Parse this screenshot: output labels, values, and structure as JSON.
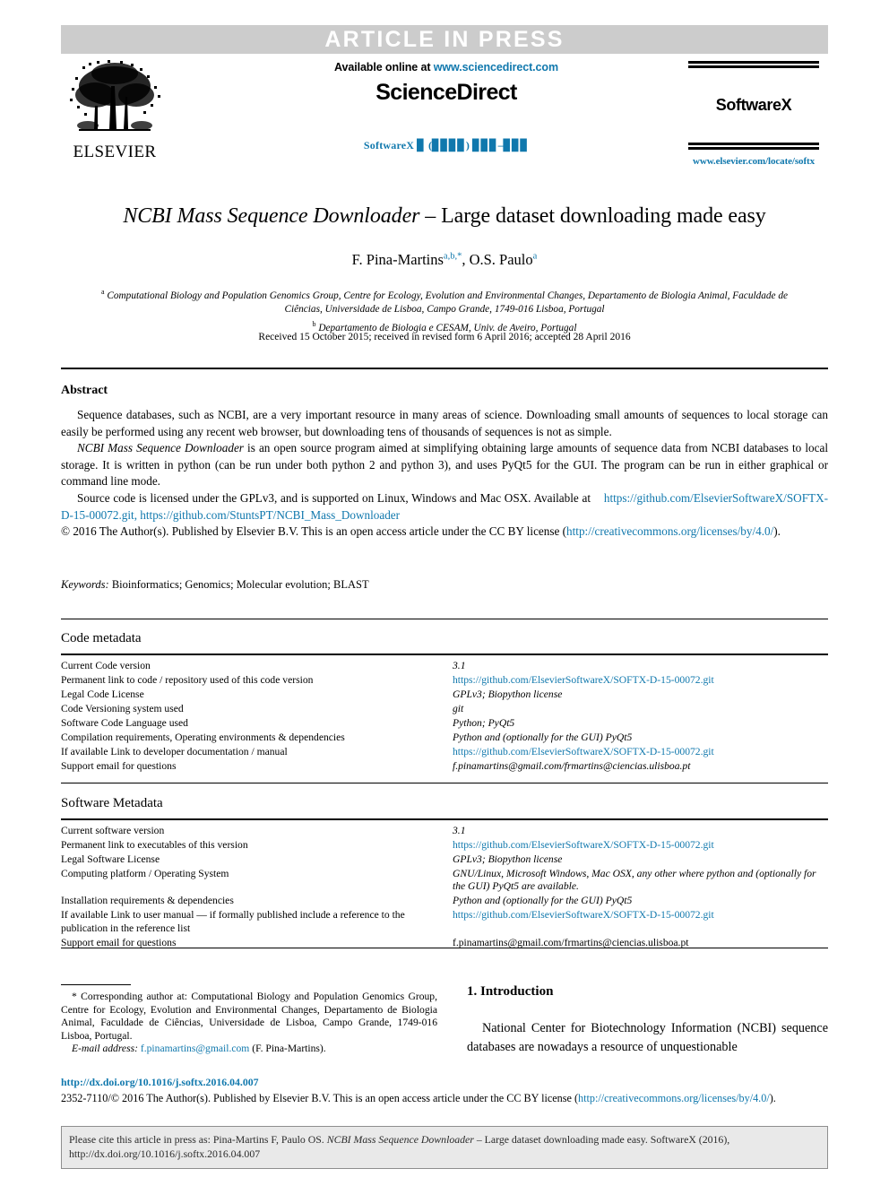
{
  "banner": {
    "text": "ARTICLE IN PRESS",
    "bg_color": "#cccccc",
    "text_color": "#ffffff"
  },
  "masthead": {
    "publisher_logo_word": "ELSEVIER",
    "available_prefix": "Available online at ",
    "available_url": "www.sciencedirect.com",
    "platform": "ScienceDirect",
    "journal_citation_line": "SoftwareX ▊ (▊▊▊▊) ▊▊▊–▊▊▊",
    "journal_name": "SoftwareX",
    "journal_url": "www.elsevier.com/locate/softx"
  },
  "article": {
    "title_italic": "NCBI Mass Sequence Downloader",
    "title_rest": " – Large dataset downloading made easy",
    "authors": [
      {
        "name": "F. Pina-Martins",
        "marks": "a,b,*"
      },
      {
        "name": "O.S. Paulo",
        "marks": "a"
      }
    ],
    "affiliations": [
      {
        "mark": "a",
        "text": "Computational Biology and Population Genomics Group, Centre for Ecology, Evolution and Environmental Changes, Departamento de Biologia Animal, Faculdade de Ciências, Universidade de Lisboa, Campo Grande, 1749-016 Lisboa, Portugal"
      },
      {
        "mark": "b",
        "text": "Departamento de Biologia e CESAM, Univ. de Aveiro, Portugal"
      }
    ],
    "history": "Received 15 October 2015; received in revised form 6 April 2016; accepted 28 April 2016"
  },
  "abstract": {
    "heading": "Abstract",
    "p1": "Sequence databases, such as NCBI, are a very important resource in many areas of science. Downloading small amounts of sequences to local storage can easily be performed using any recent web browser, but downloading tens of thousands of sequences is not as simple.",
    "p2_italic_lead": "NCBI Mass Sequence Downloader",
    "p2_rest": " is an open source program aimed at simplifying obtaining large amounts of sequence data from NCBI databases to local storage. It is written in python (can be run under both python 2 and python 3), and uses PyQt5 for the GUI. The program can be run in either graphical or command line mode.",
    "p3_lead": "Source code is licensed under the GPLv3, and is supported on Linux, Windows and Mac OSX. Available at",
    "p3_link1": "https://github.com/ElsevierSoftwareX/SOFTX-D-15-00072.git",
    "p3_link_sep": ", ",
    "p3_link2": "https://github.com/StuntsPT/NCBI_Mass_Downloader",
    "p4_lead": "© 2016 The Author(s). Published by Elsevier B.V. This is an open access article under the CC BY license (",
    "p4_link": "http://creativecommons.org/licenses/by/4.0/",
    "p4_tail": ")."
  },
  "keywords": {
    "label": "Keywords:",
    "value": " Bioinformatics; Genomics; Molecular evolution; BLAST"
  },
  "code_metadata": {
    "title": "Code metadata",
    "rows": [
      {
        "key": "Current Code version",
        "value": "3.1",
        "style": "italic"
      },
      {
        "key": "Permanent link to code / repository used of this code version",
        "value": "https://github.com/ElsevierSoftwareX/SOFTX-D-15-00072.git",
        "style": "link"
      },
      {
        "key": "Legal Code License",
        "value": "GPLv3; Biopython license",
        "style": "italic"
      },
      {
        "key": "Code Versioning system used",
        "value": "git",
        "style": "italic"
      },
      {
        "key": "Software Code Language used",
        "value": "Python; PyQt5",
        "style": "italic"
      },
      {
        "key": "Compilation requirements, Operating environments & dependencies",
        "value": "Python and (optionally for the GUI) PyQt5",
        "style": "italic"
      },
      {
        "key": "If available Link to developer documentation / manual",
        "value": "https://github.com/ElsevierSoftwareX/SOFTX-D-15-00072.git",
        "style": "link"
      },
      {
        "key": "Support email for questions",
        "value": "f.pinamartins@gmail.com/frmartins@ciencias.ulisboa.pt",
        "style": "italic"
      }
    ]
  },
  "software_metadata": {
    "title": "Software Metadata",
    "rows": [
      {
        "key": "Current software version",
        "value": "3.1",
        "style": "italic"
      },
      {
        "key": "Permanent link to executables of this version",
        "value": "https://github.com/ElsevierSoftwareX/SOFTX-D-15-00072.git",
        "style": "link"
      },
      {
        "key": "Legal Software License",
        "value": "GPLv3; Biopython license",
        "style": "italic"
      },
      {
        "key": "Computing platform / Operating System",
        "value": "GNU/Linux, Microsoft Windows, Mac OSX, any other where python and (optionally for the GUI) PyQt5 are available.",
        "style": "italic"
      },
      {
        "key": "Installation requirements & dependencies",
        "value": "Python and (optionally for the GUI) PyQt5",
        "style": "italic"
      },
      {
        "key": "If available Link to user manual — if formally published include a reference to the publication in the reference list",
        "value": "https://github.com/ElsevierSoftwareX/SOFTX-D-15-00072.git",
        "style": "link"
      },
      {
        "key": "Support email for questions",
        "value": "f.pinamartins@gmail.com/frmartins@ciencias.ulisboa.pt",
        "style": "plain"
      }
    ]
  },
  "corresponding": {
    "note": "* Corresponding author at: Computational Biology and Population Genomics Group, Centre for Ecology, Evolution and Environmental Changes, Departamento de Biologia Animal, Faculdade de Ciências, Universidade de Lisboa, Campo Grande, 1749-016 Lisboa, Portugal.",
    "email_label": "E-mail address:",
    "email": "f.pinamartins@gmail.com",
    "email_suffix": " (F. Pina-Martins)."
  },
  "introduction": {
    "heading": "1. Introduction",
    "body": "National Center for Biotechnology Information (NCBI) sequence databases are  nowadays a resource of unquestionable"
  },
  "footer": {
    "doi": "http://dx.doi.org/10.1016/j.softx.2016.04.007",
    "copyright_lead": "2352-7110/© 2016 The Author(s). Published by Elsevier B.V. This is an open access article under the CC BY license (",
    "copyright_link": "http://creativecommons.org/licenses/by/4.0/",
    "copyright_tail": ").",
    "cite_lead": "Please cite this article in press as: Pina-Martins F, Paulo OS. ",
    "cite_italic": "NCBI Mass Sequence Downloader",
    "cite_rest": " – Large dataset downloading made easy. SoftwareX (2016),",
    "cite_doi": "http://dx.doi.org/10.1016/j.softx.2016.04.007"
  },
  "colors": {
    "link": "#1078ad",
    "banner_bg": "#cccccc",
    "rule": "#000000",
    "cite_box_bg": "#e9e9e9"
  }
}
